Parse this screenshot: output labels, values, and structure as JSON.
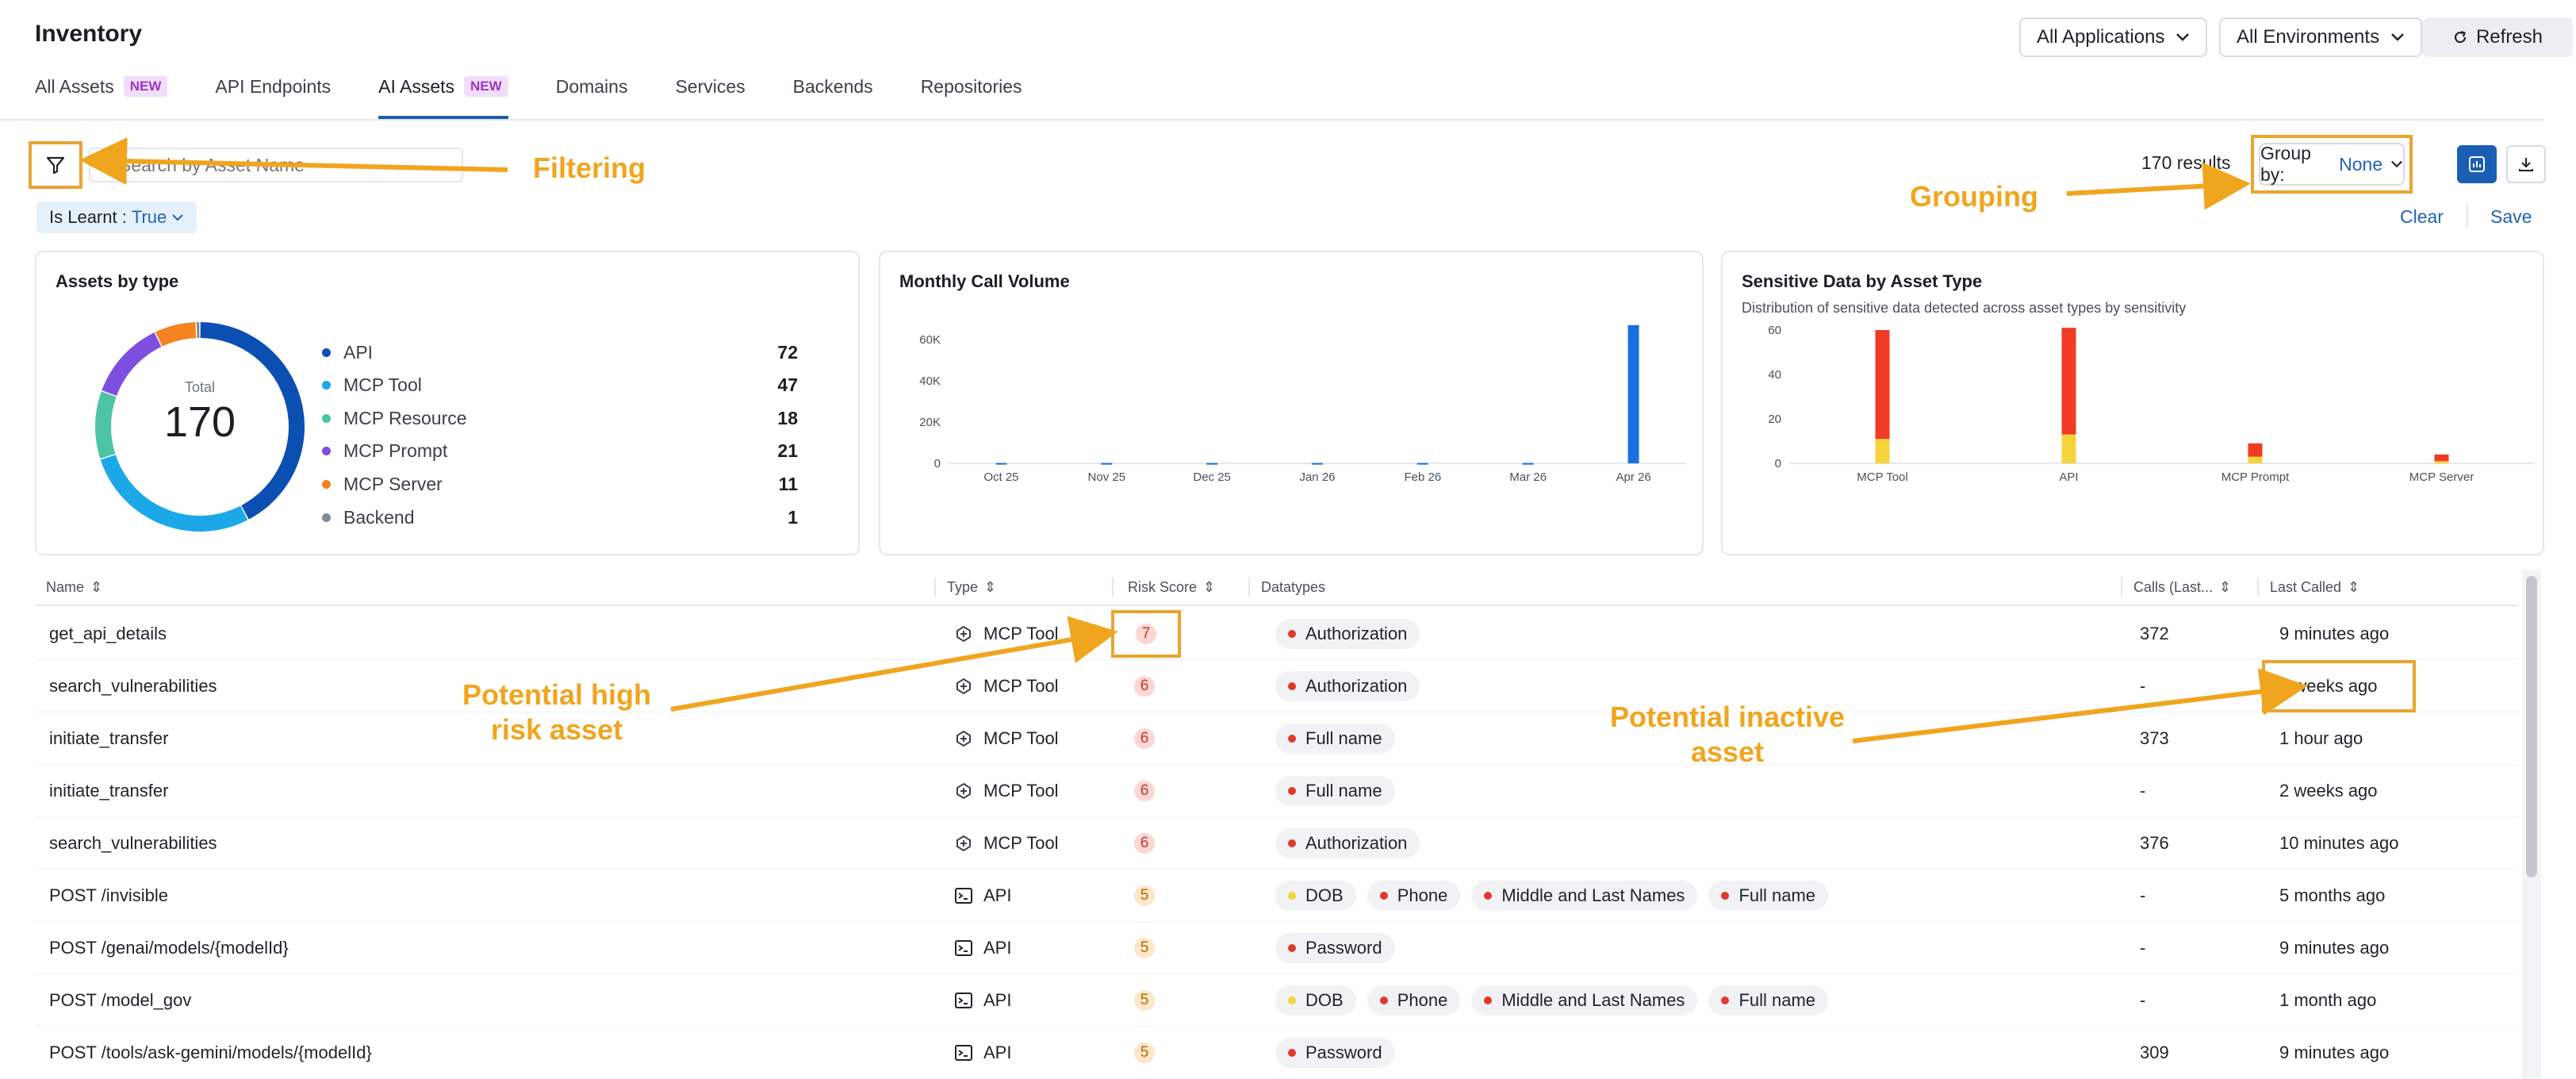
{
  "page": {
    "title": "Inventory"
  },
  "header": {
    "applications_select": "All Applications",
    "environments_select": "All Environments",
    "refresh_label": "Refresh"
  },
  "tabs": [
    {
      "label": "All Assets",
      "badge": "NEW"
    },
    {
      "label": "API Endpoints",
      "badge": ""
    },
    {
      "label": "AI Assets",
      "badge": "NEW",
      "active": true
    },
    {
      "label": "Domains",
      "badge": ""
    },
    {
      "label": "Services",
      "badge": ""
    },
    {
      "label": "Backends",
      "badge": ""
    },
    {
      "label": "Repositories",
      "badge": ""
    }
  ],
  "toolbar": {
    "search_placeholder": "Search by Asset Name",
    "filter_chip": {
      "key": "Is Learnt :",
      "value": "True"
    },
    "results": "170 results",
    "group_by_label": "Group by:",
    "group_by_value": "None",
    "clear_label": "Clear",
    "save_label": "Save"
  },
  "annotations": {
    "filtering": "Filtering",
    "grouping": "Grouping",
    "high_risk_line1": "Potential high",
    "high_risk_line2": "risk asset",
    "inactive_line1": "Potential inactive",
    "inactive_line2": "asset"
  },
  "colors": {
    "accent": "#1f63b8",
    "annotation": "#f0a51e",
    "annotation_border": "#e8a530",
    "high_risk": "#e4372b",
    "medium": "#f5d33a"
  },
  "chart_data": [
    {
      "type": "pie",
      "title": "Assets by type",
      "center_label": "Total",
      "total": "170",
      "categories": [
        "API",
        "MCP Tool",
        "MCP Resource",
        "MCP Prompt",
        "MCP Server",
        "Backend"
      ],
      "values": [
        72,
        47,
        18,
        21,
        11,
        1
      ],
      "colors": [
        "#0b4fb3",
        "#1ba8e8",
        "#4cc4a4",
        "#7e4ee0",
        "#f5821f",
        "#7e8a98"
      ]
    },
    {
      "type": "bar",
      "title": "Monthly Call Volume",
      "categories": [
        "Oct 25",
        "Nov 25",
        "Dec 25",
        "Jan 26",
        "Feb 26",
        "Mar 26",
        "Apr 26"
      ],
      "values": [
        150,
        150,
        150,
        150,
        150,
        150,
        67000
      ],
      "ylim": [
        0,
        70000
      ],
      "yticks": [
        "0",
        "20K",
        "40K",
        "60K"
      ],
      "ytick_values": [
        0,
        20000,
        40000,
        60000
      ],
      "color": "#1a6fe0"
    },
    {
      "type": "bar",
      "title": "Sensitive Data by Asset Type",
      "subtitle": "Distribution of sensitive data detected across asset types by sensitivity",
      "categories": [
        "MCP Tool",
        "API",
        "MCP Prompt",
        "MCP Server"
      ],
      "series": [
        {
          "values": [
            11,
            13,
            3,
            1
          ],
          "color": "#f5d33a"
        },
        {
          "values": [
            49,
            48,
            6,
            3
          ],
          "color": "#f03b24"
        }
      ],
      "ylim": [
        0,
        65
      ],
      "yticks": [
        "0",
        "20",
        "40",
        "60"
      ],
      "ytick_values": [
        0,
        20,
        40,
        60
      ]
    }
  ],
  "table": {
    "columns": [
      "Name",
      "Type",
      "Risk Score",
      "Datatypes",
      "Calls (Last...",
      "Last Called"
    ],
    "rows": [
      {
        "name": "get_api_details",
        "type": "MCP Tool",
        "risk": "7",
        "level": "high",
        "datatypes": [
          {
            "label": "Authorization",
            "sev": "high"
          }
        ],
        "calls": "372",
        "last_called": "9 minutes ago",
        "risk_highlight": true
      },
      {
        "name": "search_vulnerabilities",
        "type": "MCP Tool",
        "risk": "6",
        "level": "high",
        "datatypes": [
          {
            "label": "Authorization",
            "sev": "high"
          }
        ],
        "calls": "-",
        "last_called": "2 weeks ago",
        "lc_highlight": true
      },
      {
        "name": "initiate_transfer",
        "type": "MCP Tool",
        "risk": "6",
        "level": "high",
        "datatypes": [
          {
            "label": "Full name",
            "sev": "high"
          }
        ],
        "calls": "373",
        "last_called": "1 hour ago"
      },
      {
        "name": "initiate_transfer",
        "type": "MCP Tool",
        "risk": "6",
        "level": "high",
        "datatypes": [
          {
            "label": "Full name",
            "sev": "high"
          }
        ],
        "calls": "-",
        "last_called": "2 weeks ago"
      },
      {
        "name": "search_vulnerabilities",
        "type": "MCP Tool",
        "risk": "6",
        "level": "high",
        "datatypes": [
          {
            "label": "Authorization",
            "sev": "high"
          }
        ],
        "calls": "376",
        "last_called": "10 minutes ago"
      },
      {
        "name": "POST /invisible",
        "type": "API",
        "risk": "5",
        "level": "med",
        "datatypes": [
          {
            "label": "DOB",
            "sev": "med"
          },
          {
            "label": "Phone",
            "sev": "high"
          },
          {
            "label": "Middle and Last Names",
            "sev": "high"
          },
          {
            "label": "Full name",
            "sev": "high"
          }
        ],
        "calls": "-",
        "last_called": "5 months ago"
      },
      {
        "name": "POST /genai/models/{modelId}",
        "type": "API",
        "risk": "5",
        "level": "med",
        "datatypes": [
          {
            "label": "Password",
            "sev": "high"
          }
        ],
        "calls": "-",
        "last_called": "9 minutes ago"
      },
      {
        "name": "POST /model_gov",
        "type": "API",
        "risk": "5",
        "level": "med",
        "datatypes": [
          {
            "label": "DOB",
            "sev": "med"
          },
          {
            "label": "Phone",
            "sev": "high"
          },
          {
            "label": "Middle and Last Names",
            "sev": "high"
          },
          {
            "label": "Full name",
            "sev": "high"
          }
        ],
        "calls": "-",
        "last_called": "1 month ago"
      },
      {
        "name": "POST /tools/ask-gemini/models/{modelId}",
        "type": "API",
        "risk": "5",
        "level": "med",
        "datatypes": [
          {
            "label": "Password",
            "sev": "high"
          }
        ],
        "calls": "309",
        "last_called": "9 minutes ago"
      }
    ]
  }
}
